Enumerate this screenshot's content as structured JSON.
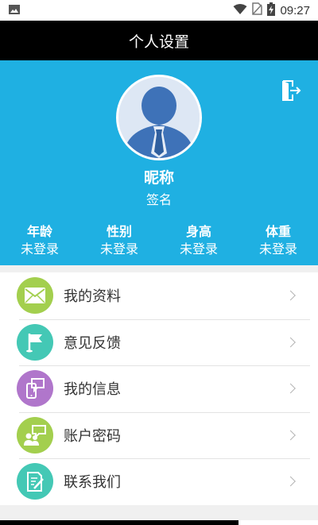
{
  "status_bar": {
    "time": "09:27",
    "icons": [
      "image-icon",
      "wifi-icon",
      "no-sim-icon",
      "battery-charging-icon"
    ]
  },
  "title_bar": {
    "title": "个人设置"
  },
  "profile": {
    "logout_icon": "logout-icon",
    "nickname": "昵称",
    "signature": "签名",
    "stats": [
      {
        "label": "年龄",
        "value": "未登录"
      },
      {
        "label": "性别",
        "value": "未登录"
      },
      {
        "label": "身高",
        "value": "未登录"
      },
      {
        "label": "体重",
        "value": "未登录"
      }
    ]
  },
  "menu": {
    "items": [
      {
        "label": "我的资料",
        "icon": "envelope-icon",
        "color": "#a3cf4e"
      },
      {
        "label": "意见反馈",
        "icon": "flag-icon",
        "color": "#44c8b5"
      },
      {
        "label": "我的信息",
        "icon": "phone-chat-icon",
        "color": "#b076cb"
      },
      {
        "label": "账户密码",
        "icon": "users-chat-icon",
        "color": "#a3cf4e"
      },
      {
        "label": "联系我们",
        "icon": "document-edit-icon",
        "color": "#44c8b5"
      }
    ]
  },
  "colors": {
    "header_bg": "#1fb0e2",
    "title_bar_bg": "#000000"
  }
}
